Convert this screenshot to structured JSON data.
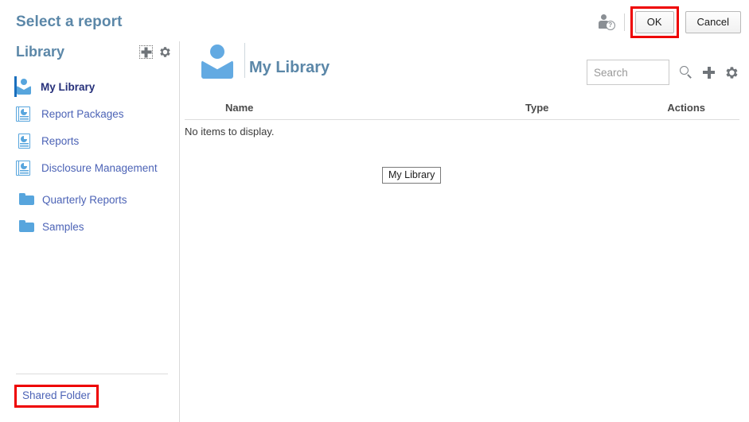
{
  "dialog": {
    "title": "Select a report",
    "help_icon": "user-help-icon",
    "ok_label": "OK",
    "cancel_label": "Cancel"
  },
  "sidebar": {
    "heading": "Library",
    "add_icon": "plus-icon",
    "settings_icon": "gear-icon",
    "items": [
      {
        "label": "My Library",
        "icon": "person-icon",
        "active": true
      },
      {
        "label": "Report Packages",
        "icon": "report-package-icon",
        "active": false
      },
      {
        "label": "Reports",
        "icon": "report-icon",
        "active": false
      },
      {
        "label": "Disclosure Management",
        "icon": "disclosure-management-icon",
        "active": false
      },
      {
        "label": "Quarterly Reports",
        "icon": "folder-icon",
        "active": false
      },
      {
        "label": "Samples",
        "icon": "folder-icon",
        "active": false
      }
    ],
    "shared_folder_label": "Shared Folder"
  },
  "main": {
    "title": "My Library",
    "title_icon": "person-icon",
    "search": {
      "value": "",
      "placeholder": "Search"
    },
    "toolbar_icons": [
      "search-icon",
      "plus-icon",
      "gear-icon"
    ],
    "table": {
      "columns": [
        "Name",
        "Type",
        "Actions"
      ],
      "empty_message": "No items to display.",
      "rows": []
    },
    "tooltip": "My Library"
  },
  "colors": {
    "accent_blue": "#5b87a8",
    "link_blue": "#4c63b6",
    "active_navy": "#26307a",
    "icon_blue": "#57a5dd",
    "highlight_red": "#ee0000"
  }
}
